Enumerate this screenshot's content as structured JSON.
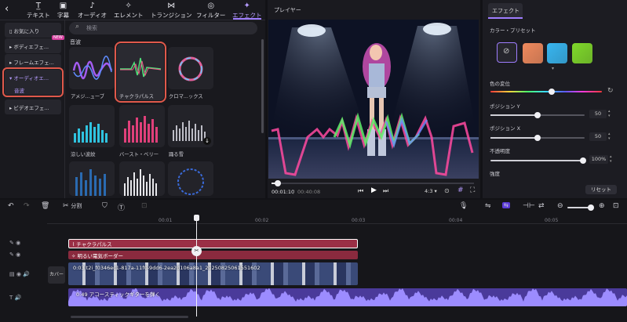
{
  "toolbar": {
    "back_icon": "chevron-left-icon",
    "tabs": [
      {
        "label": "テキスト",
        "icon": "text-icon"
      },
      {
        "label": "字幕",
        "icon": "subtitle-icon"
      },
      {
        "label": "オーディオ",
        "icon": "music-icon"
      },
      {
        "label": "エレメント",
        "icon": "element-icon"
      },
      {
        "label": "トランジション",
        "icon": "transition-icon"
      },
      {
        "label": "フィルター",
        "icon": "filter-icon"
      },
      {
        "label": "エフェクト",
        "icon": "effect-icon"
      }
    ],
    "active_tab": "エフェクト"
  },
  "categories": [
    {
      "label": "お気に入り",
      "icon": "bookmark-icon"
    },
    {
      "label": "ボディエフェ...",
      "badge": "NEW"
    },
    {
      "label": "フレームエフェ..."
    },
    {
      "label": "オーディオエ...",
      "sub": "音波",
      "selected": true
    },
    {
      "label": "ビデオエフェ..."
    }
  ],
  "search": {
    "placeholder": "検索"
  },
  "section_title": "音波",
  "effects": [
    {
      "label": "アメジ...ューブ"
    },
    {
      "label": "チャクラパルス",
      "selected": true
    },
    {
      "label": "クロマ...ックス"
    },
    {
      "label": "涼しい波紋"
    },
    {
      "label": "バースト・ベリー"
    },
    {
      "label": "踊る雪"
    }
  ],
  "player": {
    "title": "プレイヤー",
    "current_time": "00:01:10",
    "total_time": "00:40:08",
    "aspect": "4:3",
    "progress": 0.03
  },
  "right_panel": {
    "tab": "エフェクト",
    "color_preset_label": "カラー・プリセット",
    "presets": [
      "#f08a5d",
      "#38b6f0",
      "#7fd82a"
    ],
    "hue_label": "色の変位",
    "hue_value": 0.55,
    "pos_y_label": "ポジション Y",
    "pos_y_value": "50",
    "pos_x_label": "ポジション X",
    "pos_x_value": "50",
    "opacity_label": "不透明度",
    "opacity_value": "100%",
    "strength_label": "強度",
    "reset_label": "リセット"
  },
  "timeline_toolbar": {
    "split_label": "分割",
    "tick_labels": [
      "00:01",
      "00:02",
      "00:03",
      "00:04",
      "00:05"
    ]
  },
  "tracks": {
    "effect1_label": "チャクラパルス",
    "effect2_label": "明るい電気ボーダー",
    "cover_label": "カバー",
    "video_label": "0:03 t2i_f0346ec1-817a-11f0-9dd6-2ea2d106a8a1_20250825061551602",
    "audio_label": "0:49 アコースティックギターを弾く"
  }
}
